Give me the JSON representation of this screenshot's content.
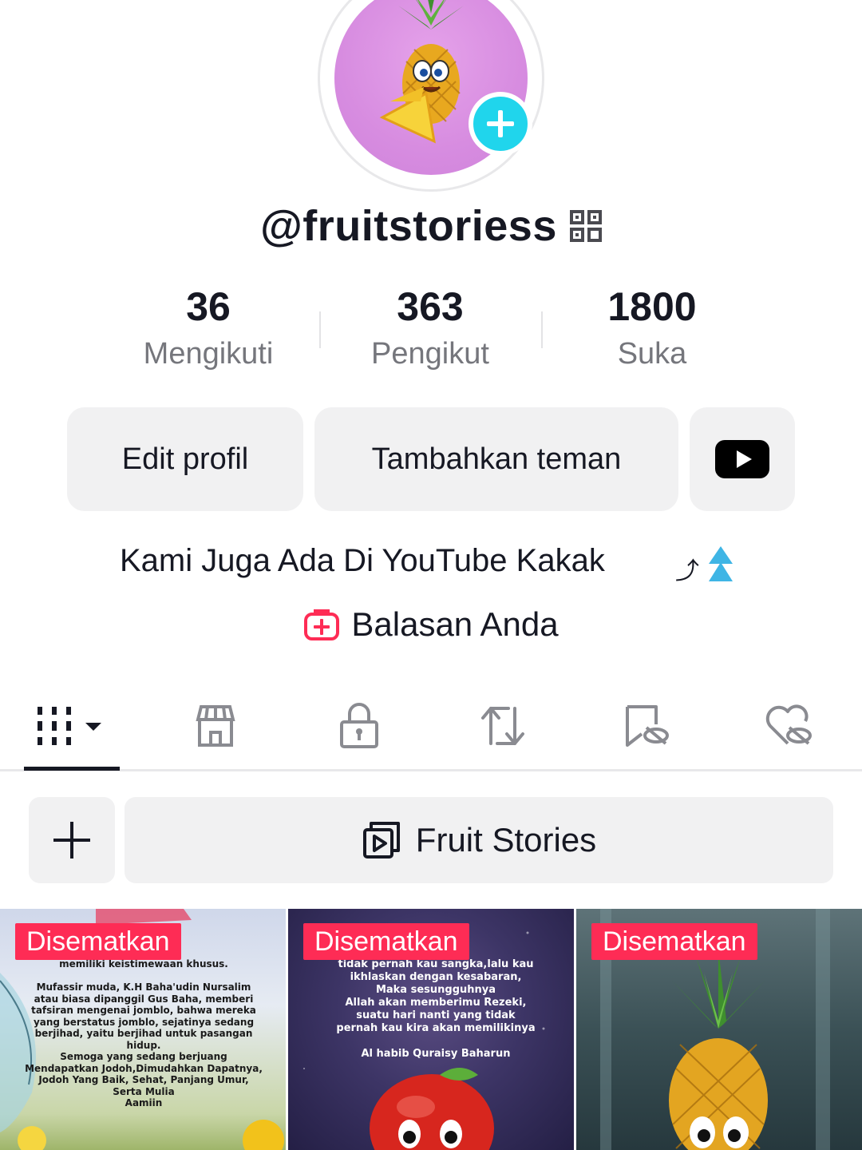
{
  "profile": {
    "username": "@fruitstoriess",
    "bio": "Kami Juga Ada Di YouTube Kakak",
    "bio_arrow": "⤴",
    "replies_label": "Balasan Anda"
  },
  "stats": [
    {
      "value": "36",
      "label": "Mengikuti"
    },
    {
      "value": "363",
      "label": "Pengikut"
    },
    {
      "value": "1800",
      "label": "Suka"
    }
  ],
  "actions": {
    "edit": "Edit profil",
    "add_friends": "Tambahkan teman"
  },
  "playlist": {
    "label": "Fruit Stories"
  },
  "videos": [
    {
      "pinned_label": "Disematkan",
      "caption": "memiliki keistimewaan khusus.\n\nMufassir muda, K.H Baha'udin Nursalim atau biasa dipanggil Gus Baha, memberi tafsiran mengenai jomblo, bahwa mereka yang berstatus jomblo, sejatinya sedang berjihad, yaitu berjihad untuk pasangan hidup.\nSemoga yang sedang berjuang Mendapatkan Jodoh,Dimudahkan Dapatnya, Jodoh Yang Baik, Sehat, Panjang Umur, Serta Mulia\nAamiin"
    },
    {
      "pinned_label": "Disematkan",
      "caption": "tidak pernah kau sangka,lalu kau ikhlaskan dengan kesabaran,\nMaka sesungguhnya\nAllah akan memberimu Rezeki,\nsuatu hari nanti yang tidak\npernah kau kira akan memilikinya\n\nAl habib Quraisy Baharun"
    },
    {
      "pinned_label": "Disematkan",
      "caption": ""
    }
  ],
  "colors": {
    "accent_pink": "#fe2c55",
    "badge_cyan": "#20d5ec",
    "text_dark": "#161823",
    "text_muted": "#75767c",
    "button_bg": "#f1f1f2"
  }
}
